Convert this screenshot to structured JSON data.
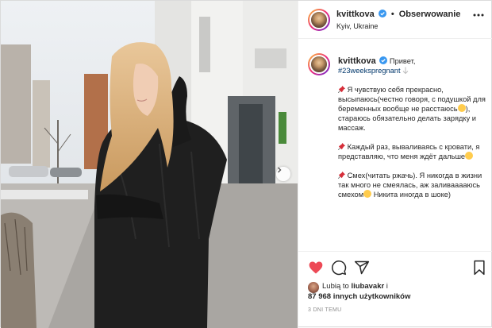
{
  "post": {
    "username": "kvittkova",
    "follow_label": "Obserwowanie",
    "location": "Kyiv, Ukraine",
    "caption": {
      "line1_greeting": "Привет,",
      "hashtag": "#23weekspregnant",
      "p1": "Я чувствую себя прекрасно, высыпаюсь(честно говоря, с подушкой для беременных вообще не расстаюсь",
      "p1_end": "), стараюсь обязательно делать зарядку и массаж.",
      "p2": "Каждый раз, вываливаясь с кровати, я представляю, что меня ждёт дальше",
      "p3_a": "Смех(читать ржачь). Я никогда в жизни так много не смеялась, аж заливааааюсь смехом",
      "p3_b": "Никита иногда в шоке)"
    },
    "likes": {
      "liked_by_prefix": "Lubią to ",
      "liked_by_user": "liubavakr",
      "liked_by_suffix": " i",
      "others": "87 968 innych użytkowników"
    },
    "time_ago": "3 DNI TEMU"
  },
  "icons": {
    "like": "heart-filled-icon",
    "comment": "comment-icon",
    "share": "share-icon",
    "save": "bookmark-icon",
    "more": "more-options-icon",
    "verified": "verified-badge-icon",
    "next": "chevron-right-icon"
  },
  "colors": {
    "like_red": "#ed4956",
    "verified_blue": "#3897f0",
    "hashtag_blue": "#00376b"
  }
}
